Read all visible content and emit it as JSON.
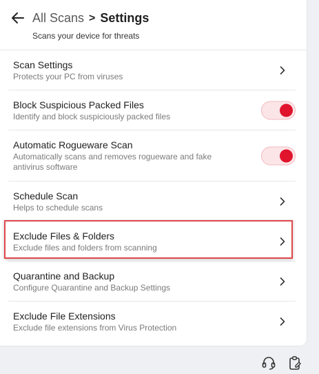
{
  "header": {
    "breadcrumb_root": "All Scans",
    "breadcrumb_sep": ">",
    "title": "Settings",
    "subtitle": "Scans your device for threats"
  },
  "settings": [
    {
      "title": "Scan Settings",
      "desc": "Protects your PC from viruses",
      "control": "chevron"
    },
    {
      "title": "Block Suspicious Packed Files",
      "desc": "Identify and block suspiciously packed files",
      "control": "toggle",
      "enabled": true
    },
    {
      "title": "Automatic Rogueware Scan",
      "desc": "Automatically scans and removes rogueware and fake antivirus software",
      "control": "toggle",
      "enabled": true
    },
    {
      "title": "Schedule Scan",
      "desc": "Helps to schedule scans",
      "control": "chevron"
    },
    {
      "title": "Exclude Files & Folders",
      "desc": "Exclude files and folders from scanning",
      "control": "chevron",
      "highlighted": true
    },
    {
      "title": "Quarantine and Backup",
      "desc": "Configure Quarantine and Backup Settings",
      "control": "chevron"
    },
    {
      "title": "Exclude File Extensions",
      "desc": "Exclude file extensions from Virus Protection",
      "control": "chevron"
    }
  ],
  "colors": {
    "toggle_on": "#e0142c",
    "toggle_track": "#fbe5e7",
    "highlight_border": "#e0474c"
  },
  "footer": {
    "icons": [
      "support-headset-icon",
      "clipboard-icon"
    ]
  }
}
